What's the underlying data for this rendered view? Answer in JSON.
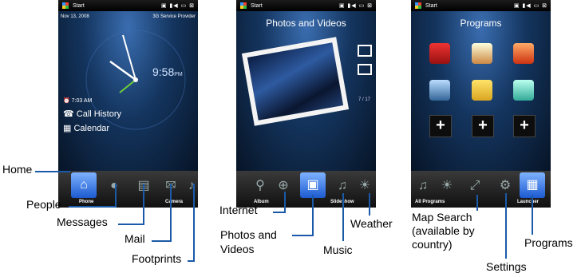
{
  "phone1": {
    "status": {
      "start": "Start"
    },
    "date": "Nov 13, 2008",
    "provider": "3G Service Provider",
    "time": "9:58",
    "time_suffix": "PM",
    "alarm": "7:03 AM",
    "call_history": "Call History",
    "calendar": "Calendar",
    "tab_left": "Phone",
    "tab_right": "Camera"
  },
  "phone2": {
    "status": {
      "start": "Start"
    },
    "title": "Photos and Videos",
    "counter": "7 / 17",
    "tab_left": "Album",
    "tab_right": "Slideshow"
  },
  "phone3": {
    "status": {
      "start": "Start"
    },
    "title": "Programs",
    "tab_left": "All Programs",
    "tab_right": "Launcher",
    "plus": "+"
  },
  "labels": {
    "home": "Home",
    "people": "People",
    "messages": "Messages",
    "mail": "Mail",
    "footprints": "Footprints",
    "internet": "Internet",
    "photos_line1": "Photos and",
    "photos_line2": "Videos",
    "music": "Music",
    "weather": "Weather",
    "map_line1": "Map Search",
    "map_line2": "(available by",
    "map_line3": "country)",
    "settings": "Settings",
    "programs": "Programs"
  },
  "colors": {
    "leader": "#1a5aa8",
    "active_tab": "#3f86f0"
  }
}
